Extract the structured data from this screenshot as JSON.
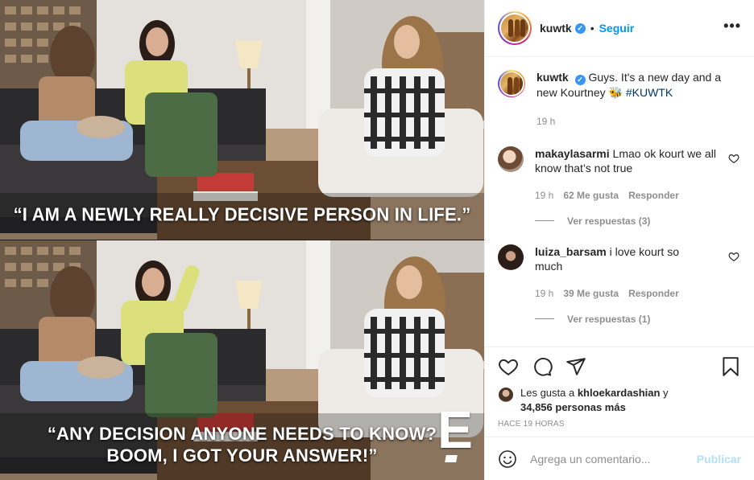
{
  "video": {
    "top_caption": "“I AM A NEWLY REALLY DECISIVE PERSON IN LIFE.”",
    "bottom_caption_line1": "“ANY DECISION ANYONE NEEDS TO KNOW?",
    "bottom_caption_line2": "BOOM, I GOT YOUR ANSWER!”",
    "watermark": "E!"
  },
  "header": {
    "username": "kuwtk",
    "separator": "•",
    "follow_label": "Seguir",
    "more_label": "•••"
  },
  "caption": {
    "username": "kuwtk",
    "text": "Guys. It's a new day and a new Kourtney 🐝 ",
    "hashtag": "#KUWTK",
    "time": "19 h"
  },
  "comments": [
    {
      "username": "makaylasarmi",
      "text": "Lmao ok kourt we all know that’s not true",
      "time": "19 h",
      "likes": "62 Me gusta",
      "reply_label": "Responder",
      "view_replies": "Ver respuestas (3)"
    },
    {
      "username": "luiza_barsam",
      "text": "i love kourt so much",
      "time": "19 h",
      "likes": "39 Me gusta",
      "reply_label": "Responder",
      "view_replies": "Ver respuestas (1)"
    }
  ],
  "likes": {
    "prefix": "Les gusta a ",
    "user": "khloekardashian",
    "middle": " y ",
    "count": "34,856 personas más"
  },
  "time_ago": "HACE 19 HORAS",
  "add_comment": {
    "placeholder": "Agrega un comentario...",
    "publish_label": "Publicar"
  },
  "colors": {
    "follow": "#0095f6",
    "hashtag": "#00376b",
    "publish_disabled": "#b2dffc",
    "verified": "#3897f0"
  },
  "icons": [
    "heart-icon",
    "comment-icon",
    "share-icon",
    "bookmark-icon",
    "emoji-icon",
    "verified-icon",
    "more-options-icon"
  ]
}
